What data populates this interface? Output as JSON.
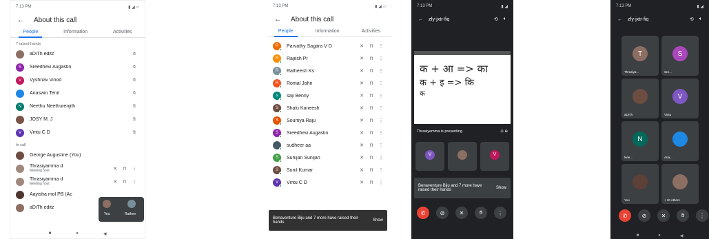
{
  "s1": {
    "status_time": "7:13 PM",
    "title": "About this call",
    "tabs": [
      "People",
      "Information",
      "Activities"
    ],
    "raised_label": "7 raised hands",
    "raised": [
      {
        "name": "aDiTh editz",
        "initial": "",
        "color": "#8d6e63"
      },
      {
        "name": "Sreedhevi Augastin",
        "initial": "S",
        "color": "#8e24aa"
      },
      {
        "name": "Vyshnav Vinod",
        "initial": "V",
        "color": "#c2185b"
      },
      {
        "name": "Anaswin Tenil",
        "initial": "",
        "color": "#1e88e5"
      },
      {
        "name": "Neethu Neethurenjith",
        "initial": "N",
        "color": "#00796b"
      },
      {
        "name": "JOSY M. J",
        "initial": "",
        "color": "#795548"
      },
      {
        "name": "Vintu C D",
        "initial": "V",
        "color": "#5e35b1"
      }
    ],
    "incall_label": "In call",
    "incall": [
      {
        "name": "George Augustine (You)",
        "sub": "",
        "color": "#6d4c41"
      },
      {
        "name": "Thrasiyamma d",
        "sub": "Meeting host",
        "color": "#a1887f"
      },
      {
        "name": "Thrasiyamma d",
        "sub": "Meeting host",
        "color": "#a1887f"
      },
      {
        "name": "Aayisha mol PB (Ac",
        "sub": "",
        "color": "#4e342e"
      },
      {
        "name": "aDiTh editz",
        "sub": "",
        "color": "#8d6e63"
      }
    ],
    "pip_you": "You",
    "pip_other": "Rathee"
  },
  "s2": {
    "status_time": "7:13 PM",
    "title": "About this call",
    "tabs": [
      "People",
      "Information",
      "Activities"
    ],
    "people": [
      {
        "name": "Parvathy Sagara V D",
        "initial": "P",
        "color": "#ef6c00"
      },
      {
        "name": "Rajesh Pr",
        "initial": "R",
        "color": "#fb8c00"
      },
      {
        "name": "Ratheesh Ks",
        "initial": "R",
        "color": "#78909c"
      },
      {
        "name": "Romal John",
        "initial": "R",
        "color": "#f4511e"
      },
      {
        "name": "saji Benny",
        "initial": "s",
        "color": "#00897b"
      },
      {
        "name": "Shalu Kaneesh",
        "initial": "S",
        "color": "#6d4c41"
      },
      {
        "name": "Soumya Raju",
        "initial": "S",
        "color": "#e65100"
      },
      {
        "name": "Sreedhevi Augastin",
        "initial": "S",
        "color": "#8e24aa"
      },
      {
        "name": "sudheer aa",
        "initial": "",
        "color": "#455a64"
      },
      {
        "name": "Sunijan Sunijan",
        "initial": "S",
        "color": "#43a047"
      },
      {
        "name": "Sunil Kumar",
        "initial": "S",
        "color": "#6d4c41"
      },
      {
        "name": "Vintu C D",
        "initial": "V",
        "color": "#5e35b1"
      }
    ],
    "toast_text": "Benaventure Biju and 7 more have raised their hands",
    "toast_action": "Show"
  },
  "s3": {
    "status_time": "7:13 PM",
    "meeting_code": "zfy-jxtr-fiq",
    "whiteboard_line1": "क + आ => का",
    "whiteboard_line2": "क + इ => कि",
    "whiteboard_line3": "क",
    "presenting": "Thrasiyamma is presenting",
    "toast_text": "Benaventure Biju and 7 more have raised their hands",
    "toast_action": "Show"
  },
  "s4": {
    "status_time": "7:13 PM",
    "meeting_code": "zfy-jxtr-fiq",
    "tiles": [
      {
        "label": "Thrasiya...",
        "initial": "T",
        "color": "#8d6e63"
      },
      {
        "label": "Sre...",
        "initial": "S",
        "color": "#ab47bc"
      },
      {
        "label": "aDiTh",
        "initial": "",
        "color": "#6d4c41"
      },
      {
        "label": "Vintu",
        "initial": "V",
        "color": "#7e57c2"
      },
      {
        "label": "Nee...",
        "initial": "N",
        "color": "#00695c"
      },
      {
        "label": "Ana...",
        "initial": "",
        "color": "#1e88e5"
      },
      {
        "label": "You",
        "initial": "",
        "color": "#5d4037"
      },
      {
        "label": "+ 30 others",
        "initial": "",
        "color": "#8d6e63"
      }
    ]
  },
  "colors": {
    "accent": "#1a73e8",
    "end_call": "#ea4335",
    "dark_bg": "#202124"
  }
}
